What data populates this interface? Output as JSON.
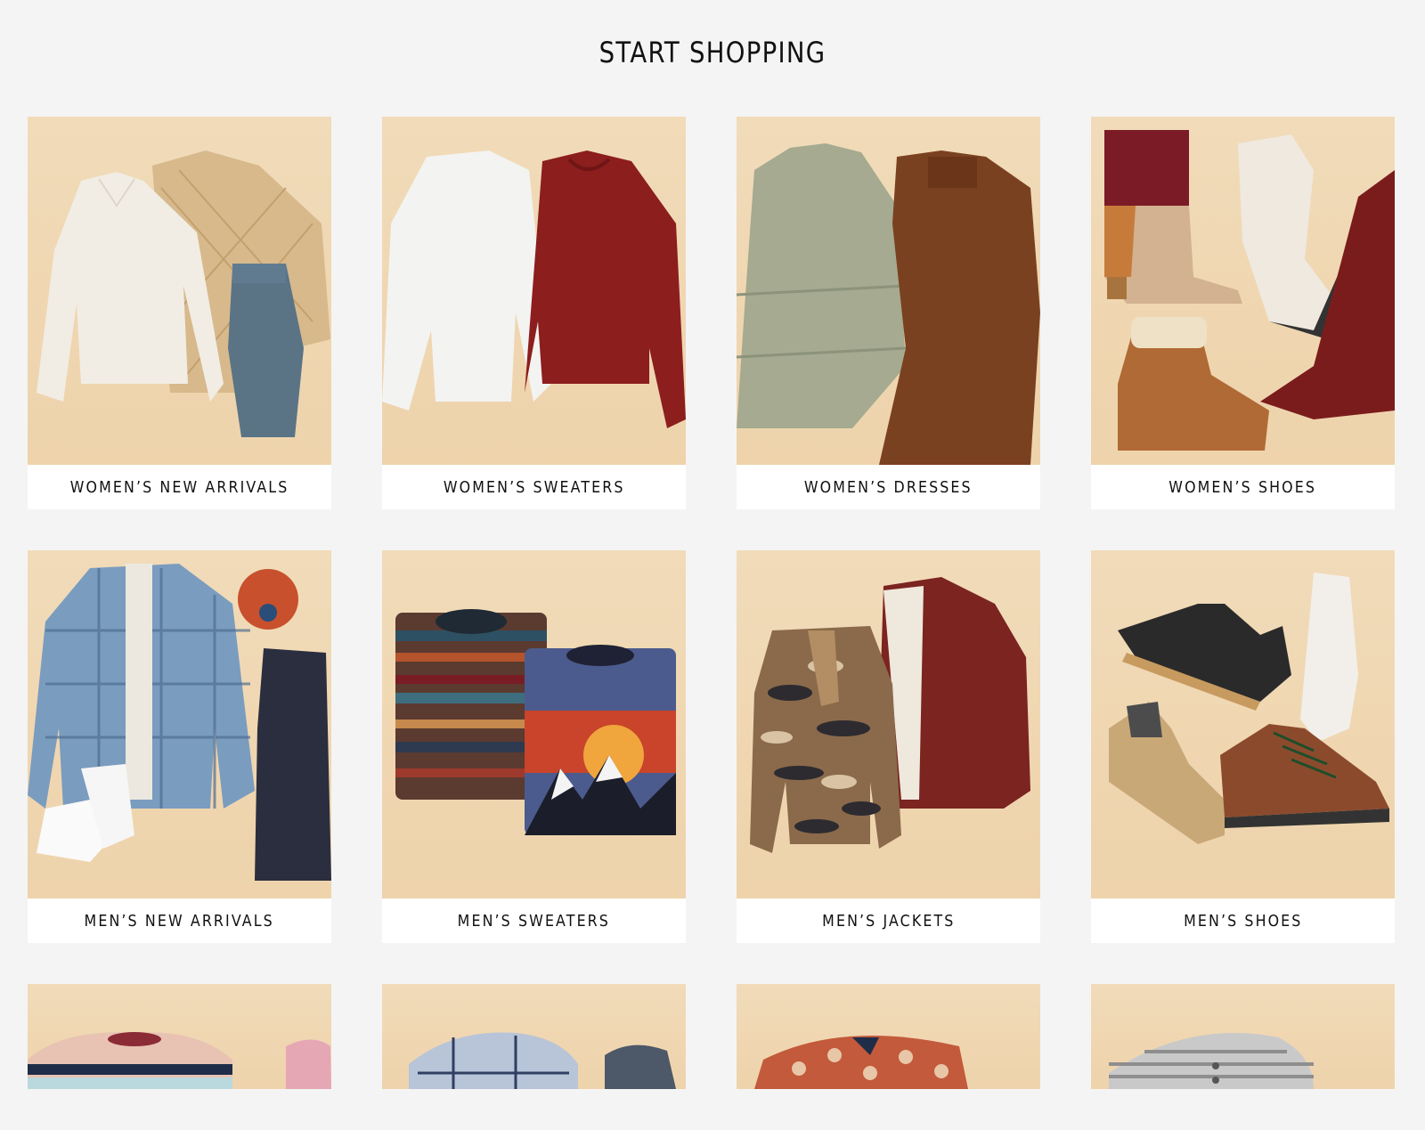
{
  "page": {
    "title": "START SHOPPING"
  },
  "categories": [
    {
      "label": "WOMEN’S NEW ARRIVALS",
      "icon": "womens-new-arrivals-image"
    },
    {
      "label": "WOMEN’S SWEATERS",
      "icon": "womens-sweaters-image"
    },
    {
      "label": "WOMEN’S DRESSES",
      "icon": "womens-dresses-image"
    },
    {
      "label": "WOMEN’S SHOES",
      "icon": "womens-shoes-image"
    },
    {
      "label": "MEN’S NEW ARRIVALS",
      "icon": "mens-new-arrivals-image"
    },
    {
      "label": "MEN’S SWEATERS",
      "icon": "mens-sweaters-image"
    },
    {
      "label": "MEN’S JACKETS",
      "icon": "mens-jackets-image"
    },
    {
      "label": "MEN’S SHOES",
      "icon": "mens-shoes-image"
    }
  ],
  "colors": {
    "background": "#f4f4f4",
    "tile": "#f0d8b4",
    "label_bg": "#ffffff",
    "text": "#111111"
  }
}
